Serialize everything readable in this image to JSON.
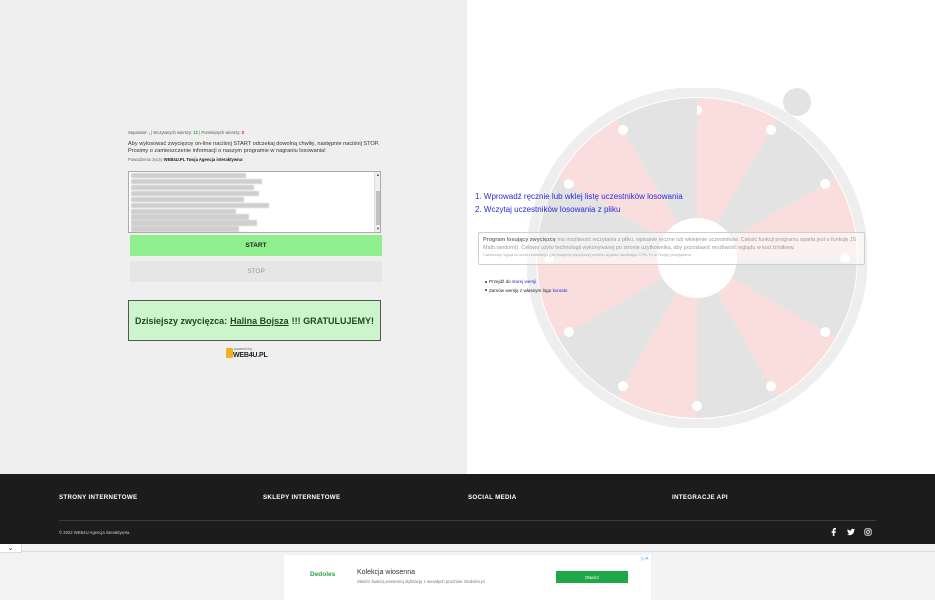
{
  "stats": {
    "separator_label": "Separator: ",
    "separator_value": ",",
    "loaded_label": " | Wczytanych wierszy: ",
    "loaded_value": "12",
    "skipped_label": " | Pominiętych wierszy: ",
    "skipped_value": "0"
  },
  "instructions": "Aby wylosować zwycięzcę on-line naciśnij START odczekaj dowolną chwilę, następnie naciśnij STOP. Prosimy o zamieszczenie informacji o naszym programie w nagraniu losowania!",
  "wish": {
    "prefix": "Powodzenia życzy ",
    "brand": "WEB4U.PL Twoja Agencja interaktywna",
    "suffix": "!"
  },
  "participants": [
    "Bożena Przybylska",
    "Dawid Kowalczyk",
    "Joanna Mazurek",
    "Elżbieta Wróbel",
    "Mateusz Kamiński",
    "Agnieszka Dudek",
    "Paweł Zieliński",
    "Krzysztof Nowicki",
    "Marta Wiśniewska",
    "Tomasz Sikora",
    "Renata Kowalska",
    "Halina Bojsza"
  ],
  "buttons": {
    "start": "START",
    "stop": "STOP"
  },
  "winner": {
    "prefix": "Dzisiejszy zwycięzca:",
    "name": "Halina Bojsza",
    "suffix": "!!! GRATULUJEMY!"
  },
  "powered": {
    "by": "powered by",
    "brand": "WEB4U.PL"
  },
  "steps": [
    "1. Wprowadź ręcznie lub wklej listę uczestników losowania",
    "2. Wczytaj uczestników losowania z pliku"
  ],
  "info": {
    "bold": "Program losujący zwycięzcę",
    "text": " ma możliwość wczytania z pliku, wpisanie ręczne lub wklejenie uczestników. Całość funkcji programu oparta jest o funkcję JS Math.random(). Celowo użyto technologii wykonywanej po stronie użytkownika, aby pozostawić możliwość wglądu w kod źródłowy.",
    "small": "Całościowy wgląd do kodu źródłowego (jak losujemy zwycięzcę) można uzyskać naciskając CTRL+U w Twojej przeglądarce."
  },
  "links": {
    "old_prefix": "Przejdź do ",
    "old_link": "starej wersji",
    "order_prefix": "Zamów wersję z własnym logo ",
    "order_link": "kontakt"
  },
  "footer": {
    "col1": "STRONY INTERNETOWE",
    "col2": "SKLEPY INTERNETOWE",
    "col3": "SOCIAL MEDIA",
    "col4": "INTEGRACJE API",
    "copyright": "© 2022 WEB4U Agencja interaktywna.",
    "social_icons": [
      "facebook-icon",
      "twitter-icon",
      "instagram-icon"
    ]
  },
  "ad": {
    "logo": "Dedoles",
    "title": "Kolekcja wiosenna",
    "description": "Stwórz świeżą wiosenną stylizację z wesołych prochów. Dedoles.pl",
    "cta": "Otwórz"
  },
  "colors": {
    "start_button": "#8fef8f",
    "winner_bg": "#ccf5cc",
    "link": "#2b2bd9",
    "footer_bg": "#1c1c1c",
    "ad_button": "#1ea84a"
  }
}
